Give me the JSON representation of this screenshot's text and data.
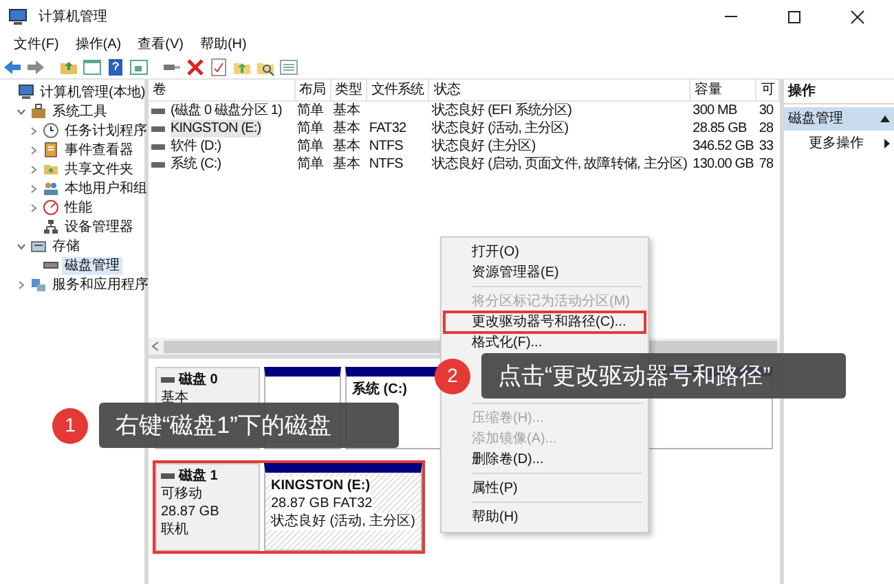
{
  "window": {
    "title": "计算机管理"
  },
  "menu_bar": [
    "文件(F)",
    "操作(A)",
    "查看(V)",
    "帮助(H)"
  ],
  "tree": [
    {
      "label": "计算机管理(本地)",
      "selected": false,
      "children": [
        {
          "label": "系统工具",
          "expanded": true,
          "selected": false,
          "children": [
            {
              "label": "任务计划程序",
              "expanded": false,
              "selected": false
            },
            {
              "label": "事件查看器",
              "expanded": false,
              "selected": false
            },
            {
              "label": "共享文件夹",
              "expanded": false,
              "selected": false
            },
            {
              "label": "本地用户和组",
              "expanded": false,
              "selected": false
            },
            {
              "label": "性能",
              "expanded": false,
              "selected": false
            },
            {
              "label": "设备管理器",
              "selected": false
            }
          ]
        },
        {
          "label": "存储",
          "expanded": true,
          "selected": false,
          "children": [
            {
              "label": "磁盘管理",
              "selected": true
            }
          ]
        },
        {
          "label": "服务和应用程序",
          "expanded": false,
          "selected": false
        }
      ]
    }
  ],
  "volumes": {
    "columns": [
      "卷",
      "布局",
      "类型",
      "文件系统",
      "状态",
      "容量",
      "可"
    ],
    "rows": [
      {
        "cells": [
          "(磁盘 0 磁盘分区 1)",
          "简单",
          "基本",
          null,
          "状态良好 (EFI 系统分区)",
          "300 MB",
          "30"
        ],
        "selected": false
      },
      {
        "cells": [
          "KINGSTON (E:)",
          "简单",
          "基本",
          "FAT32",
          "状态良好 (活动, 主分区)",
          "28.85 GB",
          "28"
        ],
        "selected": true
      },
      {
        "cells": [
          "软件 (D:)",
          "简单",
          "基本",
          "NTFS",
          "状态良好 (主分区)",
          "346.52 GB",
          "33"
        ],
        "selected": false
      },
      {
        "cells": [
          "系统 (C:)",
          "简单",
          "基本",
          "NTFS",
          "状态良好 (启动, 页面文件, 故障转储, 主分区)",
          "130.00 GB",
          "78"
        ],
        "selected": false
      }
    ]
  },
  "disks": [
    {
      "name": "磁盘 0",
      "details": [
        "基本"
      ],
      "highlighted": false,
      "partitions": [
        {
          "selected": false
        },
        {
          "lines": [
            "系统 (C:)"
          ],
          "selected": false
        }
      ]
    },
    {
      "name": "磁盘 1",
      "details": [
        "可移动",
        "28.87 GB",
        "联机"
      ],
      "highlighted": true,
      "partitions": [
        {
          "lines": [
            "KINGSTON (E:)",
            "28.87 GB FAT32",
            "状态良好 (活动, 主分区)"
          ],
          "selected": true
        }
      ]
    }
  ],
  "actions": {
    "title": "操作",
    "section": {
      "label": "磁盘管理",
      "expanded": true
    },
    "items": [
      "更多操作"
    ]
  },
  "context_menu": [
    {
      "kind": "item",
      "label": "打开(O)",
      "disabled": false,
      "highlighted": false
    },
    {
      "kind": "item",
      "label": "资源管理器(E)",
      "disabled": false,
      "highlighted": false
    },
    {
      "kind": "separator"
    },
    {
      "kind": "item",
      "label": "将分区标记为活动分区(M)",
      "disabled": true,
      "highlighted": false
    },
    {
      "kind": "item",
      "label": "更改驱动器号和路径(C)...",
      "disabled": false,
      "highlighted": true
    },
    {
      "kind": "item",
      "label": "格式化(F)...",
      "disabled": false,
      "highlighted": false
    },
    {
      "kind": "separator"
    },
    {
      "kind": "item",
      "label": "压缩卷(H)...",
      "disabled": true,
      "highlighted": false
    },
    {
      "kind": "item",
      "label": "添加镜像(A)...",
      "disabled": true,
      "highlighted": false
    },
    {
      "kind": "item",
      "label": "删除卷(D)...",
      "disabled": false,
      "highlighted": false
    },
    {
      "kind": "separator"
    },
    {
      "kind": "item",
      "label": "属性(P)",
      "disabled": false,
      "highlighted": false
    },
    {
      "kind": "separator"
    },
    {
      "kind": "item",
      "label": "帮助(H)",
      "disabled": false,
      "highlighted": false
    }
  ],
  "callouts": [
    {
      "number": "1",
      "text": "右键“磁盘1”下的磁盘"
    },
    {
      "number": "2",
      "text": "点击“更改驱动器号和路径”"
    }
  ]
}
